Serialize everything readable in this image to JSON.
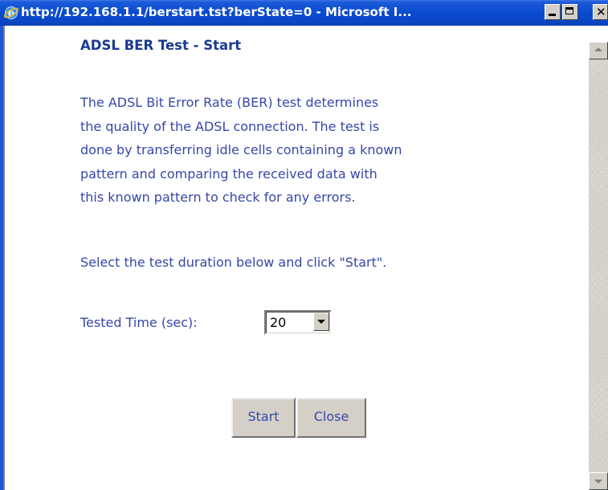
{
  "window": {
    "title": "http://192.168.1.1/berstart.tst?berState=0 - Microsoft I...",
    "icon": "ie-icon",
    "controls": {
      "minimize": "minimize-icon",
      "maximize": "maximize-icon",
      "close": "✕"
    }
  },
  "page": {
    "heading": "ADSL BER Test - Start",
    "description_lines": [
      "The ADSL Bit Error Rate (BER) test determines",
      "the quality of the ADSL connection. The test is",
      "done by transferring idle cells containing a known",
      "pattern and comparing the received data with",
      "this known pattern to check for any errors."
    ],
    "instruction": "Select the test duration below and click \"Start\".",
    "tested_time": {
      "label": "Tested Time (sec):",
      "selected_value": "20"
    },
    "buttons": {
      "start": "Start",
      "close": "Close"
    }
  },
  "colors": {
    "titlebar": "#0a4bd0",
    "heading": "#1a3a8f",
    "text": "#3747a8",
    "button_face": "#d4d0c8"
  }
}
